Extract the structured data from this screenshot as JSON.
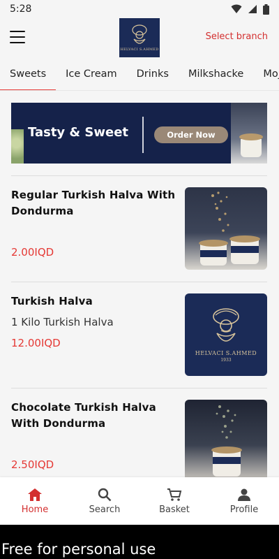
{
  "status_bar": {
    "time": "5:28"
  },
  "header": {
    "logo_text": "HELVACI S.AHMED",
    "branch_label": "Select branch"
  },
  "tabs": [
    {
      "label": "Sweets",
      "active": true
    },
    {
      "label": "Ice Cream"
    },
    {
      "label": "Drinks"
    },
    {
      "label": "Milkshacke"
    },
    {
      "label": "Mojito"
    }
  ],
  "banner": {
    "title": "Tasty & Sweet",
    "button_label": "Order Now"
  },
  "products": [
    {
      "name": "Regular Turkish Halva With Dondurma",
      "description": "",
      "price": "2.00IQD",
      "image": "halva-cups-photo"
    },
    {
      "name": "Turkish Halva",
      "description": "1 Kilo Turkish Halva",
      "price": "12.00IQD",
      "image": "helvaci-logo",
      "image_text": "HELVACI S.AHMED",
      "image_year": "1933"
    },
    {
      "name": "Chocolate Turkish Halva With Dondurma",
      "description": "",
      "price": "2.50IQD",
      "image": "chocolate-halva-photo"
    }
  ],
  "bottom_nav": [
    {
      "label": "Home",
      "icon": "home-icon",
      "active": true
    },
    {
      "label": "Search",
      "icon": "search-icon"
    },
    {
      "label": "Basket",
      "icon": "cart-icon"
    },
    {
      "label": "Profile",
      "icon": "profile-icon"
    }
  ],
  "footer": {
    "text": "Free for personal use"
  },
  "colors": {
    "accent": "#e53935",
    "brand_navy": "#1b2b57",
    "gold": "#d8c49b"
  }
}
